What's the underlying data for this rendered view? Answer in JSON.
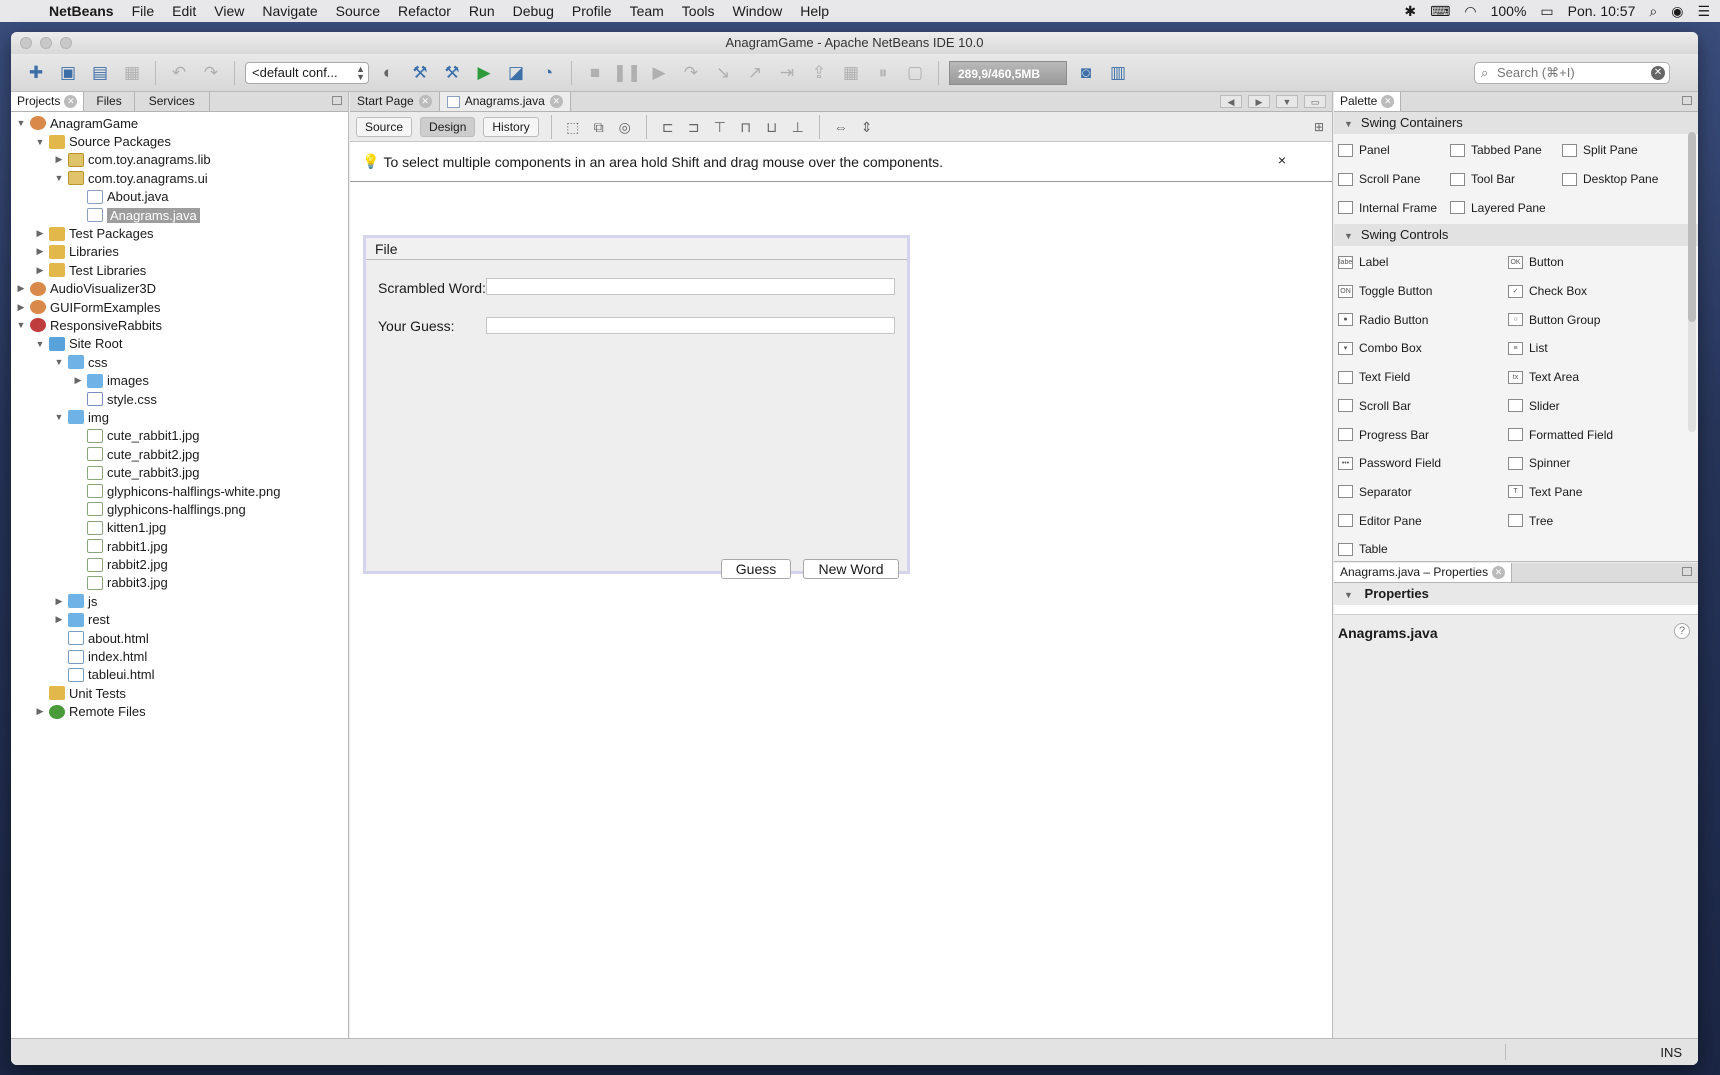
{
  "menubar": {
    "app_name": "NetBeans",
    "items": [
      "File",
      "Edit",
      "View",
      "Navigate",
      "Source",
      "Refactor",
      "Run",
      "Debug",
      "Profile",
      "Team",
      "Tools",
      "Window",
      "Help"
    ],
    "battery": "100%",
    "clock": "Pon. 10:57"
  },
  "window": {
    "title": "AnagramGame - Apache NetBeans IDE 10.0"
  },
  "toolbar": {
    "config_value": "<default conf...",
    "memory": "289,9/460,5MB",
    "search_placeholder": "Search (⌘+I)"
  },
  "projects_panel": {
    "tabs": [
      "Projects",
      "Files",
      "Services"
    ],
    "tree": [
      {
        "label": "AnagramGame",
        "depth": 0,
        "toggle": "▼",
        "icon": "proj"
      },
      {
        "label": "Source Packages",
        "depth": 1,
        "toggle": "▼",
        "icon": "pkgf"
      },
      {
        "label": "com.toy.anagrams.lib",
        "depth": 2,
        "toggle": "▶",
        "icon": "pkg"
      },
      {
        "label": "com.toy.anagrams.ui",
        "depth": 2,
        "toggle": "▼",
        "icon": "pkg"
      },
      {
        "label": "About.java",
        "depth": 3,
        "toggle": "",
        "icon": "java"
      },
      {
        "label": "Anagrams.java",
        "depth": 3,
        "toggle": "",
        "icon": "java",
        "selected": true
      },
      {
        "label": "Test Packages",
        "depth": 1,
        "toggle": "▶",
        "icon": "pkgf"
      },
      {
        "label": "Libraries",
        "depth": 1,
        "toggle": "▶",
        "icon": "pkgf"
      },
      {
        "label": "Test Libraries",
        "depth": 1,
        "toggle": "▶",
        "icon": "pkgf"
      },
      {
        "label": "AudioVisualizer3D",
        "depth": 0,
        "toggle": "▶",
        "icon": "proj"
      },
      {
        "label": "GUIFormExamples",
        "depth": 0,
        "toggle": "▶",
        "icon": "proj"
      },
      {
        "label": "ResponsiveRabbits",
        "depth": 0,
        "toggle": "▼",
        "icon": "web"
      },
      {
        "label": "Site Root",
        "depth": 1,
        "toggle": "▼",
        "icon": "sitefolder"
      },
      {
        "label": "css",
        "depth": 2,
        "toggle": "▼",
        "icon": "folder"
      },
      {
        "label": "images",
        "depth": 3,
        "toggle": "▶",
        "icon": "folder"
      },
      {
        "label": "style.css",
        "depth": 3,
        "toggle": "",
        "icon": "css"
      },
      {
        "label": "img",
        "depth": 2,
        "toggle": "▼",
        "icon": "folder"
      },
      {
        "label": "cute_rabbit1.jpg",
        "depth": 3,
        "toggle": "",
        "icon": "img"
      },
      {
        "label": "cute_rabbit2.jpg",
        "depth": 3,
        "toggle": "",
        "icon": "img"
      },
      {
        "label": "cute_rabbit3.jpg",
        "depth": 3,
        "toggle": "",
        "icon": "img"
      },
      {
        "label": "glyphicons-halflings-white.png",
        "depth": 3,
        "toggle": "",
        "icon": "img"
      },
      {
        "label": "glyphicons-halflings.png",
        "depth": 3,
        "toggle": "",
        "icon": "img"
      },
      {
        "label": "kitten1.jpg",
        "depth": 3,
        "toggle": "",
        "icon": "img"
      },
      {
        "label": "rabbit1.jpg",
        "depth": 3,
        "toggle": "",
        "icon": "img"
      },
      {
        "label": "rabbit2.jpg",
        "depth": 3,
        "toggle": "",
        "icon": "img"
      },
      {
        "label": "rabbit3.jpg",
        "depth": 3,
        "toggle": "",
        "icon": "img"
      },
      {
        "label": "js",
        "depth": 2,
        "toggle": "▶",
        "icon": "folder"
      },
      {
        "label": "rest",
        "depth": 2,
        "toggle": "▶",
        "icon": "folder"
      },
      {
        "label": "about.html",
        "depth": 2,
        "toggle": "",
        "icon": "html"
      },
      {
        "label": "index.html",
        "depth": 2,
        "toggle": "",
        "icon": "html"
      },
      {
        "label": "tableui.html",
        "depth": 2,
        "toggle": "",
        "icon": "html"
      },
      {
        "label": "Unit Tests",
        "depth": 1,
        "toggle": "",
        "icon": "pkgf"
      },
      {
        "label": "Remote Files",
        "depth": 1,
        "toggle": "▶",
        "icon": "globe"
      }
    ]
  },
  "editor": {
    "tabs": [
      "Start Page",
      "Anagrams.java"
    ],
    "view_buttons": [
      "Source",
      "Design",
      "History"
    ],
    "hint": "To select multiple components in an area hold Shift and drag mouse over the components.",
    "hint_close": "×",
    "form": {
      "menu": "File",
      "scrambled_label": "Scrambled Word:",
      "guess_label": "Your Guess:",
      "guess_button": "Guess",
      "new_word_button": "New Word"
    }
  },
  "palette": {
    "tab": "Palette",
    "categories": [
      {
        "name": "Swing Containers",
        "items": [
          {
            "label": "Panel",
            "glyph": ""
          },
          {
            "label": "Tabbed Pane",
            "glyph": ""
          },
          {
            "label": "Split Pane",
            "glyph": ""
          },
          {
            "label": "Scroll Pane",
            "glyph": ""
          },
          {
            "label": "Tool Bar",
            "glyph": ""
          },
          {
            "label": "Desktop Pane",
            "glyph": ""
          },
          {
            "label": "Internal Frame",
            "glyph": ""
          },
          {
            "label": "Layered Pane",
            "glyph": ""
          }
        ]
      },
      {
        "name": "Swing Controls",
        "items": [
          {
            "label": "Label",
            "glyph": "label"
          },
          {
            "label": "Button",
            "glyph": "OK"
          },
          {
            "label": "Toggle Button",
            "glyph": "ON"
          },
          {
            "label": "Check Box",
            "glyph": "✓"
          },
          {
            "label": "Radio Button",
            "glyph": "●"
          },
          {
            "label": "Button Group",
            "glyph": "○"
          },
          {
            "label": "Combo Box",
            "glyph": "▾"
          },
          {
            "label": "List",
            "glyph": "≡"
          },
          {
            "label": "Text Field",
            "glyph": ""
          },
          {
            "label": "Text Area",
            "glyph": "tx"
          },
          {
            "label": "Scroll Bar",
            "glyph": ""
          },
          {
            "label": "Slider",
            "glyph": ""
          },
          {
            "label": "Progress Bar",
            "glyph": ""
          },
          {
            "label": "Formatted Field",
            "glyph": ""
          },
          {
            "label": "Password Field",
            "glyph": "•••"
          },
          {
            "label": "Spinner",
            "glyph": ""
          },
          {
            "label": "Separator",
            "glyph": ""
          },
          {
            "label": "Text Pane",
            "glyph": "T"
          },
          {
            "label": "Editor Pane",
            "glyph": ""
          },
          {
            "label": "Tree",
            "glyph": ""
          },
          {
            "label": "Table",
            "glyph": ""
          }
        ]
      }
    ]
  },
  "properties": {
    "tab": "Anagrams.java – Properties",
    "section": "Properties",
    "title": "Anagrams.java",
    "help": "?"
  },
  "statusbar": {
    "mode": "INS"
  }
}
